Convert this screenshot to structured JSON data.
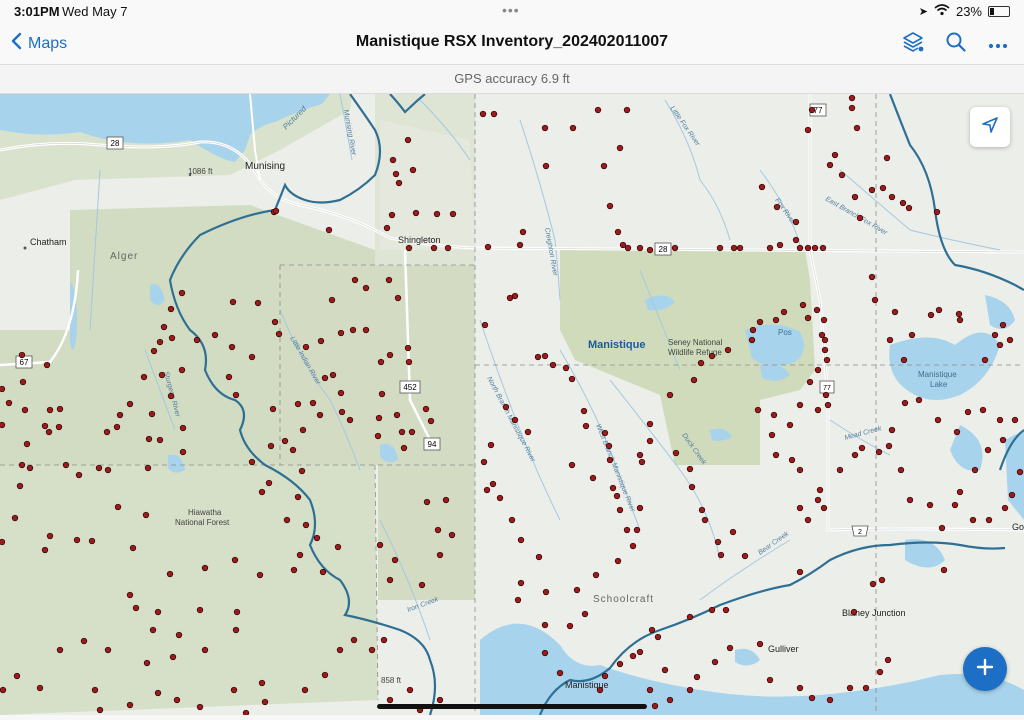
{
  "status": {
    "time": "3:01PM",
    "date": "Wed May 7",
    "battery_text": "23%",
    "battery_level": 0.23
  },
  "nav": {
    "back_label": "Maps",
    "title": "Manistique RSX Inventory_202402011007"
  },
  "icons": {
    "back": "chevron-left-icon",
    "layers": "layers-icon",
    "search": "search-icon",
    "more": "ellipsis-icon",
    "locate": "location-arrow-icon",
    "add": "plus-icon"
  },
  "gps": {
    "text": "GPS accuracy 6.9 ft"
  },
  "colors": {
    "accent": "#1c6fc5",
    "point": "#9c1c1c",
    "water": "#a8d3ec",
    "forest": "#cfdbbf",
    "boundary": "#2e6f94"
  },
  "map": {
    "labels": {
      "munising": "Munising",
      "elev1086": "1086 ft",
      "chatham": "Chatham",
      "alger": "Alger",
      "shingleton": "Shingleton",
      "manistique_region": "Manistique",
      "seney": "Seney National",
      "seney2": "Wildlife Refuge",
      "hiawatha": "Hiawatha",
      "hiawatha2": "National Forest",
      "schoolcraft": "Schoolcraft",
      "blaney": "Blaney Junction",
      "gulliver": "Gulliver",
      "manistique_town": "Manistique",
      "manistique_lake": "Manistique",
      "manistique_lake2": "Lake",
      "elev858": "858 ft",
      "pictured": "Pictured",
      "littlefox": "Little Fox River",
      "foxriver": "Fox River",
      "eastbranchfox": "East Branch Fox River",
      "creightonriver": "Creighton River",
      "northbranch": "North Branch Manistique River",
      "westbranch": "West Branch Manistique River",
      "duckcreek": "Duck Creek",
      "meadcreek": "Mead Creek",
      "bearcreek": "Bear Creek",
      "ironcreek": "Iron Creek",
      "littleindian": "Little Indian River",
      "sturgeon": "Sturgeon River",
      "goprefix": "Go",
      "bigpine": "Pos",
      "munisingriver": "Munising River"
    },
    "shields": {
      "r28a": "28",
      "r28b": "28",
      "r77": "77",
      "r67": "67",
      "r94": "94",
      "r452": "452",
      "r2": "2",
      "r77b": "77"
    }
  }
}
